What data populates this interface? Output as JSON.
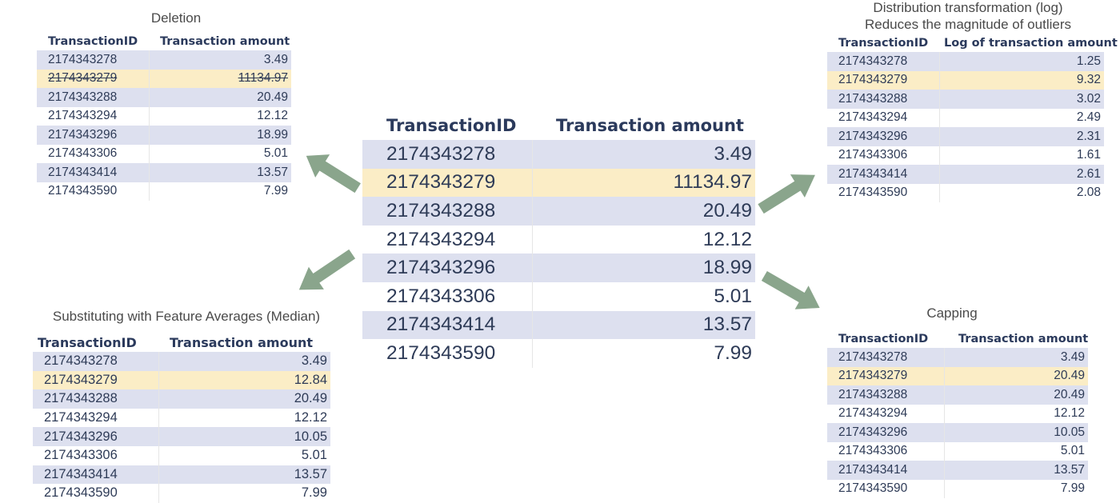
{
  "colors": {
    "band": "#dde0ef",
    "highlight": "#fbedc6",
    "arrow": "#8aa58c",
    "header_text": "#2b3a5c"
  },
  "center": {
    "headers": [
      "TransactionID",
      "Transaction amount"
    ],
    "rows": [
      [
        "2174343278",
        "3.49"
      ],
      [
        "2174343279",
        "11134.97"
      ],
      [
        "2174343288",
        "20.49"
      ],
      [
        "2174343294",
        "12.12"
      ],
      [
        "2174343296",
        "18.99"
      ],
      [
        "2174343306",
        "5.01"
      ],
      [
        "2174343414",
        "13.57"
      ],
      [
        "2174343590",
        "7.99"
      ]
    ]
  },
  "deletion": {
    "title": "Deletion",
    "headers": [
      "TransactionID",
      "Transaction amount"
    ],
    "rows": [
      [
        "2174343278",
        "3.49"
      ],
      [
        "2174343279",
        "11134.97"
      ],
      [
        "2174343288",
        "20.49"
      ],
      [
        "2174343294",
        "12.12"
      ],
      [
        "2174343296",
        "18.99"
      ],
      [
        "2174343306",
        "5.01"
      ],
      [
        "2174343414",
        "13.57"
      ],
      [
        "2174343590",
        "7.99"
      ]
    ]
  },
  "log": {
    "title_line1": "Distribution transformation (log)",
    "title_line2": "Reduces the magnitude of outliers",
    "headers": [
      "TransactionID",
      "Log of transaction amount"
    ],
    "rows": [
      [
        "2174343278",
        "1.25"
      ],
      [
        "2174343279",
        "9.32"
      ],
      [
        "2174343288",
        "3.02"
      ],
      [
        "2174343294",
        "2.49"
      ],
      [
        "2174343296",
        "2.31"
      ],
      [
        "2174343306",
        "1.61"
      ],
      [
        "2174343414",
        "2.61"
      ],
      [
        "2174343590",
        "2.08"
      ]
    ]
  },
  "median": {
    "title": "Substituting with Feature Averages (Median)",
    "headers": [
      "TransactionID",
      "Transaction amount"
    ],
    "rows": [
      [
        "2174343278",
        "3.49"
      ],
      [
        "2174343279",
        "12.84"
      ],
      [
        "2174343288",
        "20.49"
      ],
      [
        "2174343294",
        "12.12"
      ],
      [
        "2174343296",
        "10.05"
      ],
      [
        "2174343306",
        "5.01"
      ],
      [
        "2174343414",
        "13.57"
      ],
      [
        "2174343590",
        "7.99"
      ]
    ]
  },
  "capping": {
    "title": "Capping",
    "headers": [
      "TransactionID",
      "Transaction amount"
    ],
    "rows": [
      [
        "2174343278",
        "3.49"
      ],
      [
        "2174343279",
        "20.49"
      ],
      [
        "2174343288",
        "20.49"
      ],
      [
        "2174343294",
        "12.12"
      ],
      [
        "2174343296",
        "10.05"
      ],
      [
        "2174343306",
        "5.01"
      ],
      [
        "2174343414",
        "13.57"
      ],
      [
        "2174343590",
        "7.99"
      ]
    ]
  }
}
